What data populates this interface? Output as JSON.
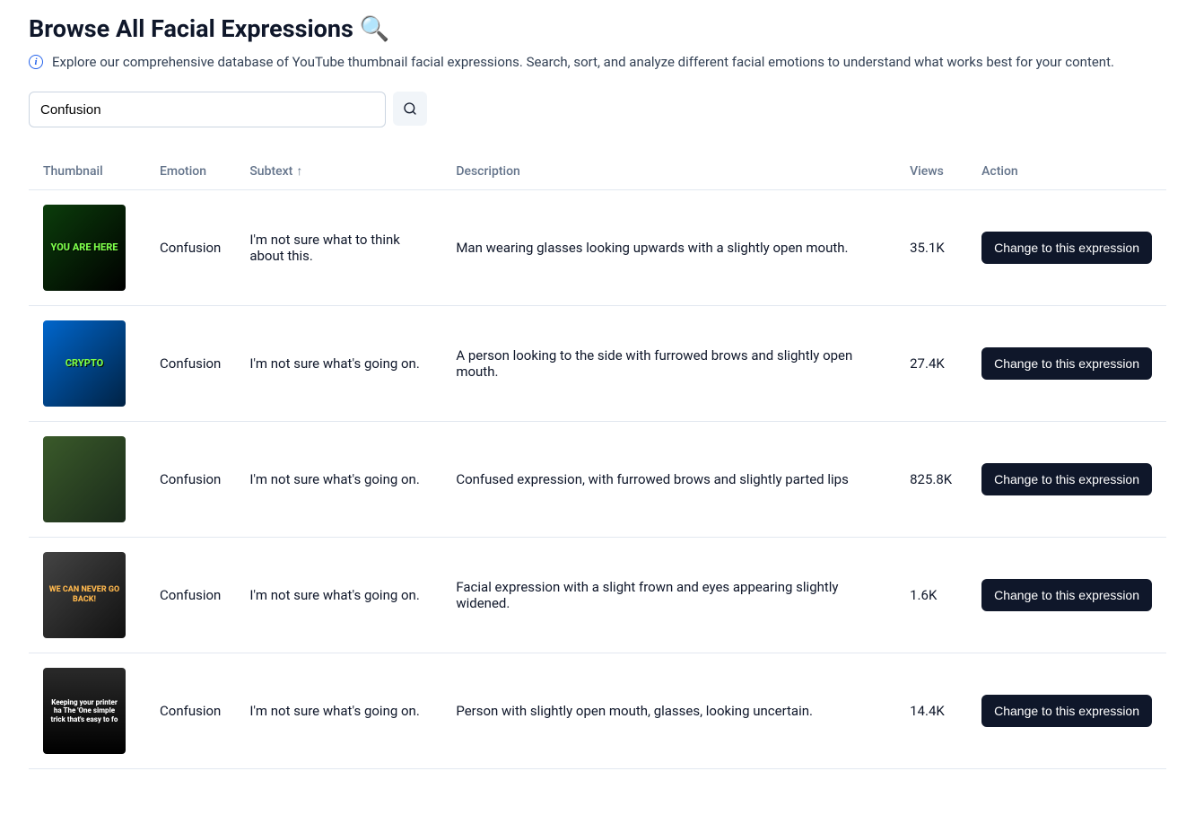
{
  "title": "Browse All Facial Expressions 🔍",
  "subtitle": "Explore our comprehensive database of YouTube thumbnail facial expressions. Search, sort, and analyze different facial emotions to understand what works best for your content.",
  "search": {
    "value": "Confusion",
    "placeholder": ""
  },
  "columns": {
    "thumbnail": "Thumbnail",
    "emotion": "Emotion",
    "subtext": "Subtext",
    "sort_arrow": "↑",
    "description": "Description",
    "views": "Views",
    "action": "Action"
  },
  "action_label": "Change to this expression",
  "rows": [
    {
      "thumb_text": "YOU ARE HERE",
      "thumb_class": "t1",
      "emotion": "Confusion",
      "subtext": "I'm not sure what to think about this.",
      "description": "Man wearing glasses looking upwards with a slightly open mouth.",
      "views": "35.1K"
    },
    {
      "thumb_text": "CRYPTO",
      "thumb_class": "t2",
      "emotion": "Confusion",
      "subtext": "I'm not sure what's going on.",
      "description": "A person looking to the side with furrowed brows and slightly open mouth.",
      "views": "27.4K"
    },
    {
      "thumb_text": "",
      "thumb_class": "t3",
      "emotion": "Confusion",
      "subtext": "I'm not sure what's going on.",
      "description": "Confused expression, with furrowed brows and slightly parted lips",
      "views": "825.8K"
    },
    {
      "thumb_text": "WE CAN NEVER GO BACK!",
      "thumb_class": "t4",
      "emotion": "Confusion",
      "subtext": "I'm not sure what's going on.",
      "description": "Facial expression with a slight frown and eyes appearing slightly widened.",
      "views": "1.6K"
    },
    {
      "thumb_text": "Keeping your printer ha The 'One simple trick that's easy to fo",
      "thumb_class": "t5",
      "emotion": "Confusion",
      "subtext": "I'm not sure what's going on.",
      "description": "Person with slightly open mouth, glasses, looking uncertain.",
      "views": "14.4K"
    }
  ]
}
